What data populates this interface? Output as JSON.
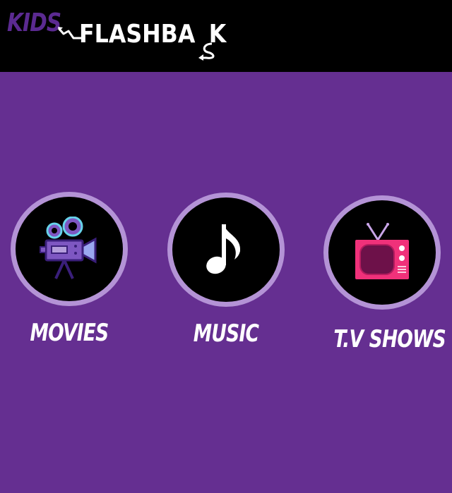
{
  "header": {
    "logo_kids": "KIDS",
    "logo_flashback_left": "FLASHBA",
    "logo_flashback_right": "K",
    "colors": {
      "background": "#000000",
      "kids": "#5b2a91",
      "flashback": "#ffffff"
    }
  },
  "main": {
    "background": "#652f91",
    "categories": [
      {
        "label": "MOVIES",
        "icon": "movie-camera-icon"
      },
      {
        "label": "MUSIC",
        "icon": "music-note-icon"
      },
      {
        "label": "T.V SHOWS",
        "icon": "television-icon"
      }
    ],
    "circle_border_color": "#b493d6"
  }
}
